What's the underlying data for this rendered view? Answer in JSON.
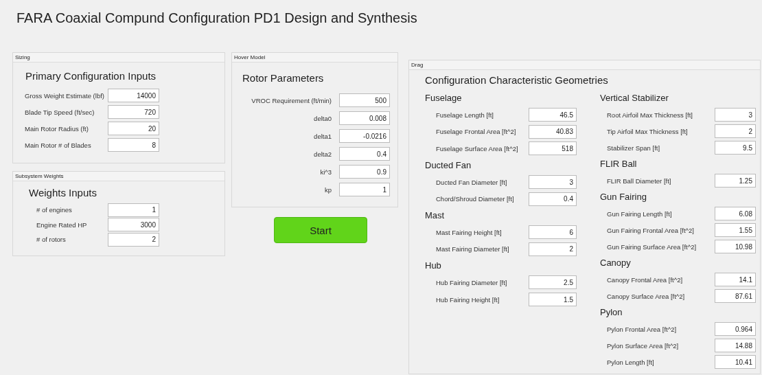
{
  "title": "FARA Coaxial Compund Configuration PD1 Design and Synthesis",
  "panels": [
    {
      "title": "Sizing",
      "heading": "Primary Configuration Inputs",
      "fields": [
        {
          "label": "Gross Weight Estimate (lbf)",
          "value": "14000"
        },
        {
          "label": "Blade Tip Speed (ft/sec)",
          "value": "720"
        },
        {
          "label": "Main Rotor Radius (ft)",
          "value": "20"
        },
        {
          "label": "Main Rotor # of Blades",
          "value": "8"
        }
      ]
    },
    {
      "title": "Subsystem Weights",
      "heading": "Weights Inputs",
      "fields": [
        {
          "label": "# of engines",
          "value": "1"
        },
        {
          "label": "Engine Rated HP",
          "value": "3000"
        },
        {
          "label": "# of rotors",
          "value": "2"
        }
      ]
    },
    {
      "title": "Hover Model",
      "heading": "Rotor Parameters",
      "fields": [
        {
          "label": "VROC Requirement (ft/min)",
          "value": "500"
        },
        {
          "label": "delta0",
          "value": "0.008"
        },
        {
          "label": "delta1",
          "value": "-0.0216"
        },
        {
          "label": "delta2",
          "value": "0.4"
        },
        {
          "label": "ki^3",
          "value": "0.9"
        },
        {
          "label": "kp",
          "value": "1"
        }
      ]
    }
  ],
  "start_button": "Start",
  "drag": {
    "title": "Drag",
    "heading": "Configuration Characteristic Geometries",
    "columns": [
      [
        {
          "heading": "Fuselage",
          "fields": [
            {
              "label": "Fuselage Length [ft]",
              "value": "46.5"
            },
            {
              "label": "Fuselage Frontal Area [ft^2]",
              "value": "40.83"
            },
            {
              "label": "Fuselage Surface Area [ft^2]",
              "value": "518"
            }
          ]
        },
        {
          "heading": "Ducted Fan",
          "fields": [
            {
              "label": "Ducted Fan Diameter [ft]",
              "value": "3"
            },
            {
              "label": "Chord/Shroud Diameter [ft]",
              "value": "0.4"
            }
          ]
        },
        {
          "heading": "Mast",
          "fields": [
            {
              "label": "Mast Fairing Height [ft]",
              "value": "6"
            },
            {
              "label": "Mast Fairing Diameter [ft]",
              "value": "2"
            }
          ]
        },
        {
          "heading": "Hub",
          "fields": [
            {
              "label": "Hub Fairing Diameter [ft]",
              "value": "2.5"
            },
            {
              "label": "Hub Fairing Height [ft]",
              "value": "1.5"
            }
          ]
        }
      ],
      [
        {
          "heading": "Vertical Stabilizer",
          "fields": [
            {
              "label": "Root Airfoil Max Thickness [ft]",
              "value": "3"
            },
            {
              "label": "Tip Airfoil Max Thickness [ft]",
              "value": "2"
            },
            {
              "label": "Stabilizer Span [ft]",
              "value": "9.5"
            }
          ]
        },
        {
          "heading": "FLIR Ball",
          "fields": [
            {
              "label": "FLIR Ball Diameter [ft]",
              "value": "1.25"
            }
          ]
        },
        {
          "heading": "Gun Fairing",
          "fields": [
            {
              "label": "Gun Fairing Length [ft]",
              "value": "6.08"
            },
            {
              "label": "Gun Fairing Frontal Area [ft^2]",
              "value": "1.55"
            },
            {
              "label": "Gun Fairing Surface Area [ft^2]",
              "value": "10.98"
            }
          ]
        },
        {
          "heading": "Canopy",
          "fields": [
            {
              "label": "Canopy Frontal Area [ft^2]",
              "value": "14.1"
            },
            {
              "label": "Canopy Surface Area [ft^2]",
              "value": "87.61"
            }
          ]
        },
        {
          "heading": "Pylon",
          "fields": [
            {
              "label": "Pylon Frontal Area [ft^2]",
              "value": "0.964"
            },
            {
              "label": "Pylon Surface Area [ft^2]",
              "value": "14.88"
            },
            {
              "label": "Pylon Length [ft]",
              "value": "10.41"
            }
          ]
        }
      ]
    ]
  }
}
